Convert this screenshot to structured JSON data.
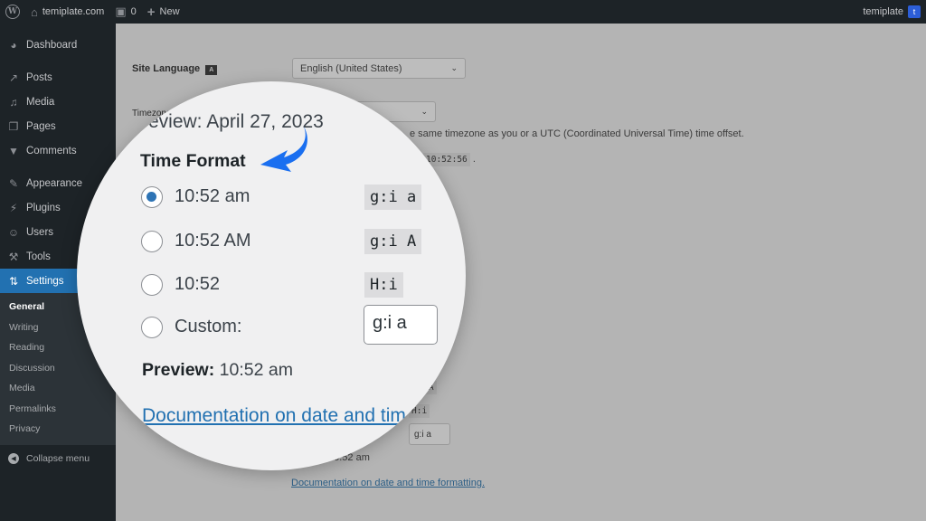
{
  "admin_bar": {
    "wp_logo_icon": "wordpress-logo-icon",
    "site_name": "temiplate.com",
    "comments_count": "0",
    "new_label": "New",
    "user_name": "temiplate",
    "avatar_letter": "t"
  },
  "sidebar": {
    "items": [
      {
        "label": "Dashboard",
        "icon": "dashboard-icon",
        "glyph": "◕"
      },
      {
        "label": "Posts",
        "icon": "pin-icon",
        "glyph": "↗"
      },
      {
        "label": "Media",
        "icon": "media-icon",
        "glyph": "♫"
      },
      {
        "label": "Pages",
        "icon": "pages-icon",
        "glyph": "❐"
      },
      {
        "label": "Comments",
        "icon": "comment-icon",
        "glyph": "▼"
      },
      {
        "label": "Appearance",
        "icon": "paintbrush-icon",
        "glyph": "✎"
      },
      {
        "label": "Plugins",
        "icon": "plugin-icon",
        "glyph": "⚡"
      },
      {
        "label": "Users",
        "icon": "user-icon",
        "glyph": "☺"
      },
      {
        "label": "Tools",
        "icon": "wrench-icon",
        "glyph": "⚒"
      },
      {
        "label": "Settings",
        "icon": "settings-icon",
        "glyph": "⇅"
      }
    ],
    "submenu": [
      "General",
      "Writing",
      "Reading",
      "Discussion",
      "Media",
      "Permalinks",
      "Privacy"
    ],
    "current_submenu": "General",
    "collapse_label": "Collapse menu"
  },
  "background": {
    "site_language_label": "Site Language",
    "site_language_value": "English (United States)",
    "timezone_label": "Timezone",
    "timezone_hint": "e same timezone as you or a UTC (Coordinated Universal Time) time offset.",
    "universal_time": "10:52:56",
    "time_format_codes": [
      "g:i A",
      "H:i"
    ],
    "custom_value": "g:i a",
    "preview_time": "10:52 am",
    "doc_link": "Documentation on date and time formatting."
  },
  "magnifier": {
    "date_preview_prefix": "review:",
    "date_preview_value": "April 27, 2023",
    "section_title": "Time Format",
    "options": [
      {
        "label": "10:52 am",
        "code": "g:i a",
        "checked": true
      },
      {
        "label": "10:52 AM",
        "code": "g:i A",
        "checked": false
      },
      {
        "label": "10:52",
        "code": "H:i",
        "checked": false
      },
      {
        "label": "Custom:",
        "code": null,
        "checked": false
      }
    ],
    "custom_input_value": "g:i a",
    "preview_label": "Preview:",
    "preview_value": "10:52 am",
    "doc_link_partial": "Documentation on date and tim"
  },
  "colors": {
    "accent": "#2271b1",
    "arrow": "#1a6ff0",
    "sidebar_bg": "#1d2327"
  }
}
